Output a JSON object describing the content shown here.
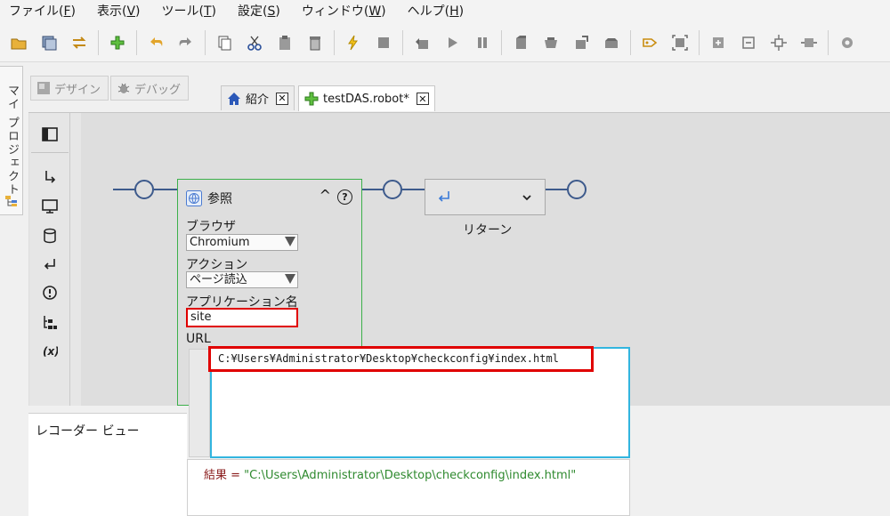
{
  "menu": [
    {
      "label": "ファイル(",
      "key": "F",
      "end": ")"
    },
    {
      "label": "表示(",
      "key": "V",
      "end": ")"
    },
    {
      "label": "ツール(",
      "key": "T",
      "end": ")"
    },
    {
      "label": "設定(",
      "key": "S",
      "end": ")"
    },
    {
      "label": "ウィンドウ(",
      "key": "W",
      "end": ")"
    },
    {
      "label": "ヘルプ(",
      "key": "H",
      "end": ")"
    }
  ],
  "toolbar_icons": [
    "open-folder-icon",
    "save-all-icon",
    "swap-icon",
    "add-robot-icon",
    "undo-icon",
    "redo-icon",
    "copy-icon",
    "cut-icon",
    "paste-icon",
    "delete-icon",
    "lightning-icon",
    "stop-icon",
    "step-back-icon",
    "play-icon",
    "pause-icon",
    "step-a-icon",
    "step-b-icon",
    "step-c-icon",
    "step-d-icon",
    "tag-icon",
    "frame-icon",
    "add-node-icon",
    "remove-node-icon",
    "focus-icon",
    "fit-icon",
    "settings-icon"
  ],
  "project_tab": {
    "label": "マイ プロジェクト"
  },
  "mode_tabs": {
    "design": "デザイン",
    "debug": "デバッグ"
  },
  "editor_tabs": {
    "intro": "紹介",
    "robot": "testDAS.robot*"
  },
  "step": {
    "title": "参照",
    "browser_label": "ブラウザ",
    "browser_value": "Chromium",
    "action_label": "アクション",
    "action_value": "ページ読込",
    "appname_label": "アプリケーション名",
    "appname_value": "site",
    "url_label": "URL",
    "url_value": "C:¥Users¥Administrator¥Desktop¥checkconfig¥index.html"
  },
  "result": {
    "label": "結果 = ",
    "value": "\"C:\\Users\\Administrator\\Desktop\\checkconfig\\index.html\""
  },
  "return_step": {
    "label": "リターン"
  },
  "recorder": {
    "label": "レコーダー ビュー"
  },
  "colors": {
    "flow": "#3d5a8c",
    "step_border": "#3cb04a",
    "highlight": "#e00000",
    "editor_focus": "#32b5df"
  }
}
